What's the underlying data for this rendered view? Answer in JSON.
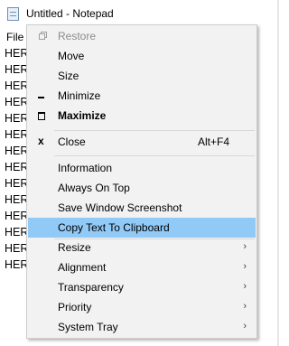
{
  "window": {
    "title": "Untitled - Notepad",
    "menu_file": "File"
  },
  "editor": {
    "lines": [
      "HER",
      "HER",
      "HER",
      "HER",
      "HER",
      "HER",
      "HER",
      "HER",
      "HER",
      "HER",
      "HER",
      "HER",
      "HER",
      "HER"
    ]
  },
  "context_menu": {
    "items": [
      {
        "label": "Restore",
        "icon": "restore-icon",
        "disabled": true
      },
      {
        "label": "Move"
      },
      {
        "label": "Size"
      },
      {
        "label": "Minimize",
        "icon": "minimize-icon"
      },
      {
        "label": "Maximize",
        "icon": "maximize-icon",
        "bold": true
      },
      {
        "label": "Close",
        "icon": "close-icon",
        "shortcut": "Alt+F4"
      },
      {
        "label": "Information"
      },
      {
        "label": "Always On Top"
      },
      {
        "label": "Save Window Screenshot"
      },
      {
        "label": "Copy Text To Clipboard",
        "highlighted": true
      },
      {
        "label": "Resize",
        "submenu": true
      },
      {
        "label": "Alignment",
        "submenu": true
      },
      {
        "label": "Transparency",
        "submenu": true
      },
      {
        "label": "Priority",
        "submenu": true
      },
      {
        "label": "System Tray",
        "submenu": true
      }
    ],
    "submenu_arrow": "›"
  },
  "colors": {
    "menu_background": "#f2f2f2",
    "highlight": "#91c9f7",
    "disabled_text": "#8c8c8c"
  }
}
